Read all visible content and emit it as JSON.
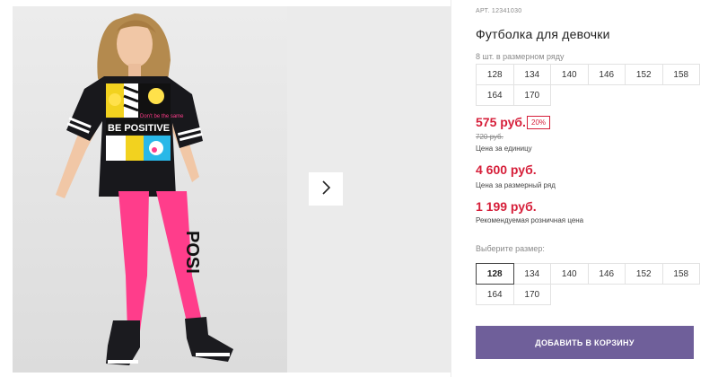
{
  "product": {
    "sku": "АРТ. 12341030",
    "title": "Футболка для девочки"
  },
  "size_row": {
    "label": "8 шт. в размерном ряду",
    "sizes": [
      "128",
      "134",
      "140",
      "146",
      "152",
      "158",
      "164",
      "170"
    ]
  },
  "pricing": {
    "unit_price": "575 руб.",
    "discount": "20%",
    "old_price": "720 руб.",
    "unit_note": "Цена за единицу",
    "row_price": "4 600 руб.",
    "row_note": "Цена за размерный ряд",
    "rrp_price": "1 199 руб.",
    "rrp_note": "Рекомендуемая розничная цена"
  },
  "size_select": {
    "label": "Выберите размер:",
    "selected": "128",
    "sizes": [
      "128",
      "134",
      "140",
      "146",
      "152",
      "158",
      "164",
      "170"
    ]
  },
  "cart": {
    "label": "ДОБАВИТЬ В КОРЗИНУ"
  },
  "gallery": {
    "next_icon": "chevron-right-icon",
    "print_lines": [
      "BE POSITIVE",
      "Don't be the same"
    ]
  },
  "colors": {
    "price": "#d61f3a",
    "cart_button": "#6f5f9a",
    "leggings": "#ff3d8b"
  }
}
